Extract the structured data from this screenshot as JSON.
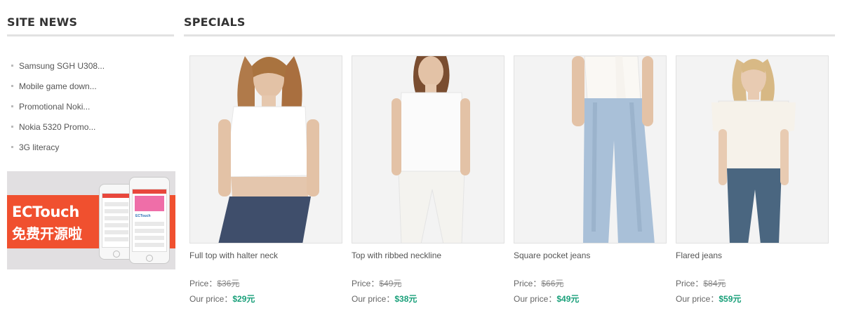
{
  "site_news": {
    "title": "SITE NEWS",
    "items": [
      {
        "label": "Samsung SGH U308..."
      },
      {
        "label": "Mobile game down..."
      },
      {
        "label": "Promotional Noki..."
      },
      {
        "label": "Nokia 5320 Promo..."
      },
      {
        "label": "3G literacy"
      }
    ]
  },
  "banner": {
    "brand": "ECTouch",
    "tagline": "免费开源啦",
    "phone_brand": "ECTouch",
    "colors": {
      "red": "#f0502f",
      "background": "#e1dfe1"
    }
  },
  "specials": {
    "title": "SPECIALS",
    "price_label": "Price：",
    "our_price_label": "Our price：",
    "products": [
      {
        "name": "Full top with halter neck",
        "old_price": "$36元",
        "new_price": "$29元"
      },
      {
        "name": "Top with ribbed neckline",
        "old_price": "$49元",
        "new_price": "$38元"
      },
      {
        "name": "Square pocket jeans",
        "old_price": "$66元",
        "new_price": "$49元"
      },
      {
        "name": "Flared jeans",
        "old_price": "$84元",
        "new_price": "$59元"
      }
    ]
  },
  "colors": {
    "accent_green": "#1aa07a",
    "divider": "#e2e2e2"
  }
}
